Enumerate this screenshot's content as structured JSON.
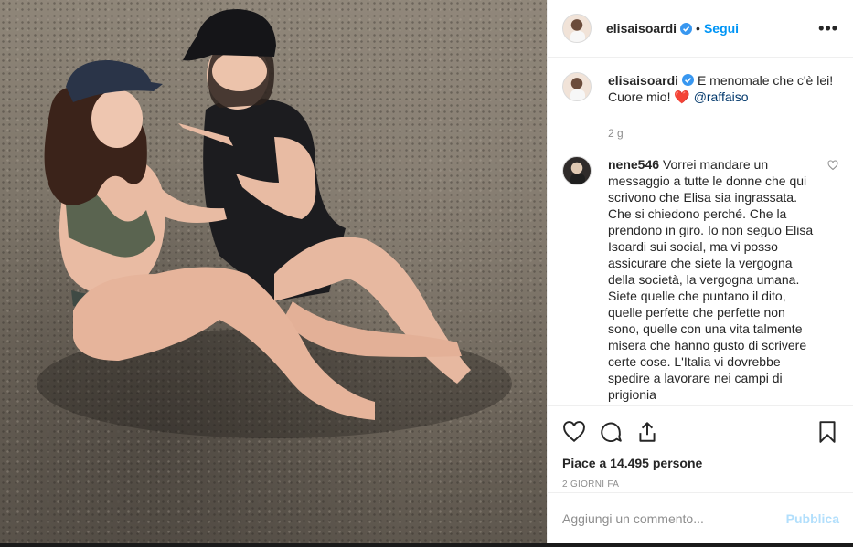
{
  "header": {
    "username": "elisaisoardi",
    "separator": "•",
    "follow_label": "Segui",
    "more_label": "•••"
  },
  "caption": {
    "username": "elisaisoardi",
    "text": "E menomale che c'è lei! Cuore mio!",
    "emoji": "❤️",
    "mention": "@raffaiso",
    "time": "2 g"
  },
  "comment": {
    "username": "nene546",
    "text": "Vorrei mandare un messaggio a tutte le donne che qui scrivono che Elisa sia ingrassata. Che si chiedono perché. Che la prendono in giro. Io non seguo Elisa Isoardi sui social, ma vi posso assicurare che siete la vergogna della società, la vergogna umana. Siete quelle che puntano il dito, quelle perfette che perfette non sono, quelle con una vita talmente misera che hanno gusto di scrivere certe cose. L'Italia vi dovrebbe spedire a lavorare nei campi di prigionia"
  },
  "actions": {
    "likes_text": "Piace a 14.495 persone",
    "date": "2 GIORNI FA"
  },
  "add_comment": {
    "placeholder": "Aggiungi un commento...",
    "publish_label": "Pubblica"
  },
  "colors": {
    "accent": "#0095f6",
    "heart": "#ed4956",
    "muted": "#8e8e8e",
    "publish_disabled": "#b2dffc"
  },
  "icons": [
    "verified-badge-icon",
    "like-icon",
    "comment-icon",
    "share-icon",
    "save-icon",
    "small-heart-icon"
  ]
}
